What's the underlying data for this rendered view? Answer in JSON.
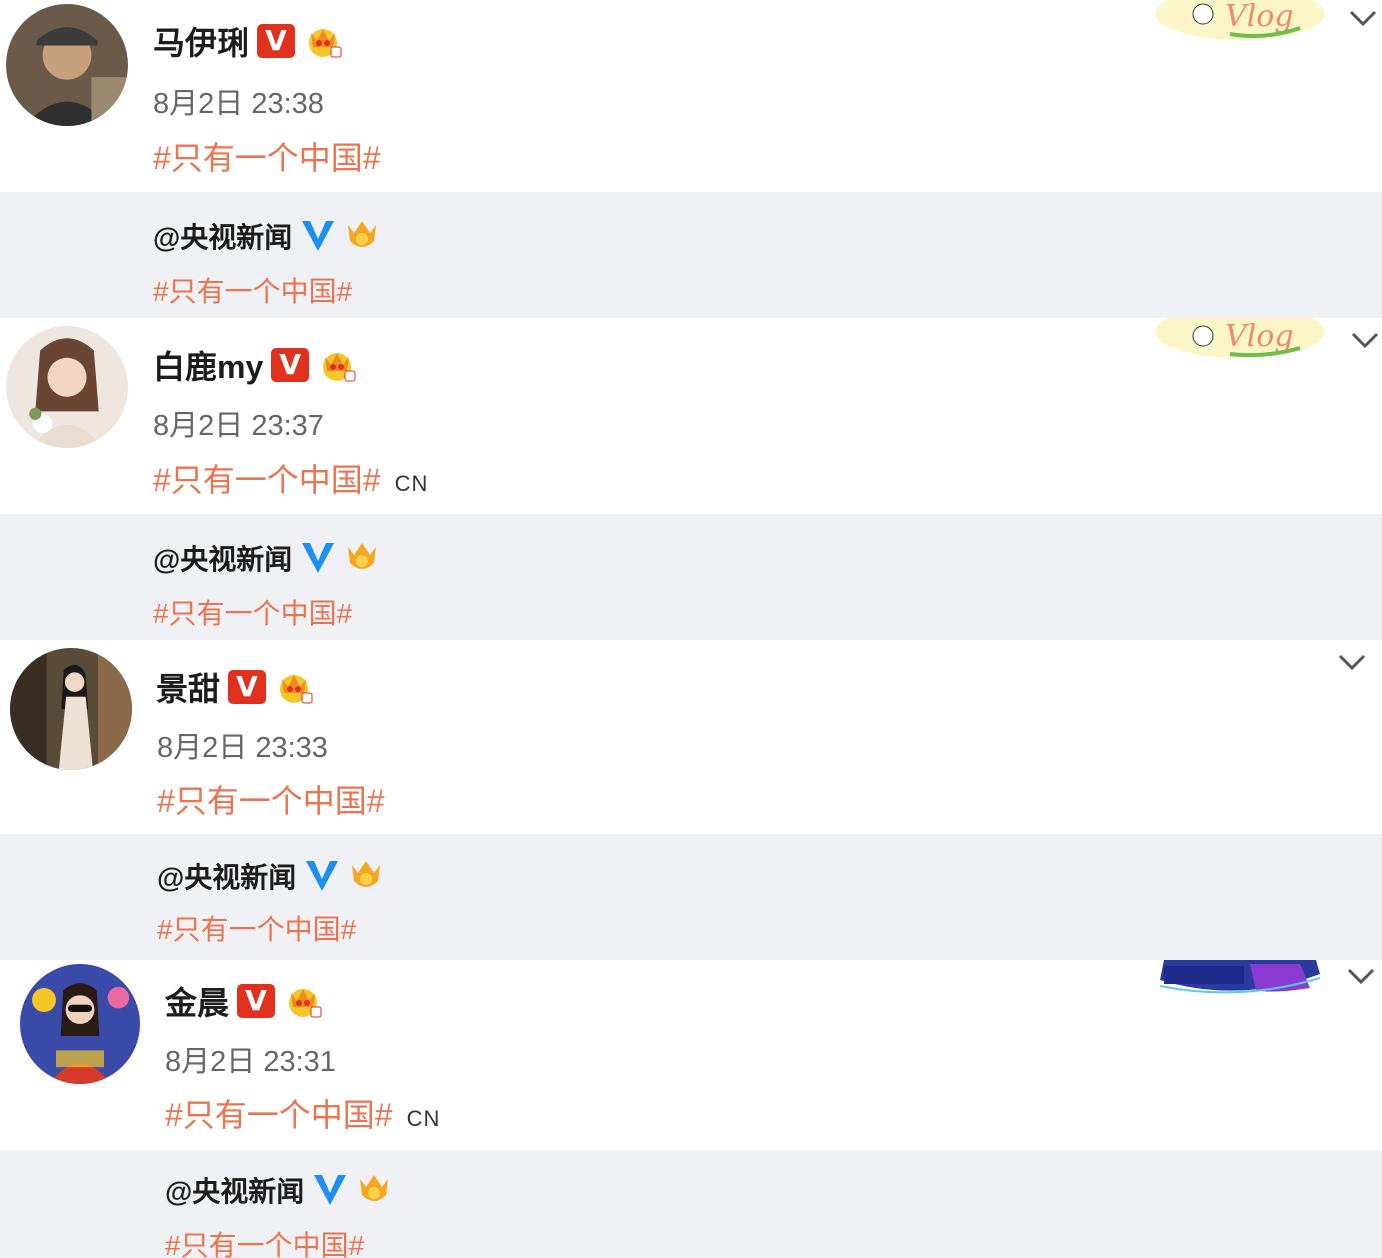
{
  "posts": [
    {
      "author": "马伊琍",
      "time": "8月2日 23:38",
      "tag": "#只有一个中国#",
      "suffix": "",
      "repost_author": "@央视新闻",
      "repost_tag": "#只有一个中国#",
      "sticker": "vlog-sticker"
    },
    {
      "author": "白鹿my",
      "time": "8月2日 23:37",
      "tag": "#只有一个中国#",
      "suffix": "CN",
      "repost_author": "@央视新闻",
      "repost_tag": "#只有一个中国#",
      "sticker": "vlog-sticker"
    },
    {
      "author": "景甜",
      "time": "8月2日 23:33",
      "tag": "#只有一个中国#",
      "suffix": "",
      "repost_author": "@央视新闻",
      "repost_tag": "#只有一个中国#",
      "sticker": ""
    },
    {
      "author": "金晨",
      "time": "8月2日 23:31",
      "tag": "#只有一个中国#",
      "suffix": "CN",
      "repost_author": "@央视新闻",
      "repost_tag": "#只有一个中国#",
      "sticker": "carnival-banner-sticker"
    }
  ],
  "badges": {
    "v": "V"
  },
  "colors": {
    "tag": "#eb7350",
    "vbadge": "#e0301e",
    "bluev": "#1d8ff0",
    "repost_bg": "#f0f1f4"
  }
}
